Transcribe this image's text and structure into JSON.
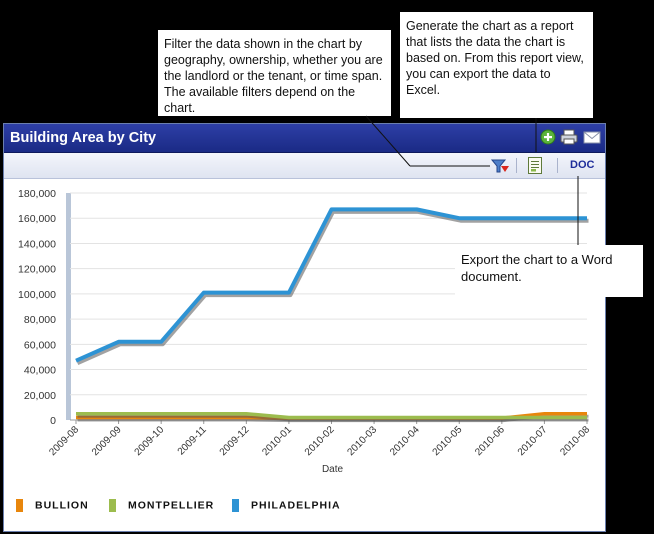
{
  "callouts": {
    "filter": "Filter the data shown in the chart by geography, ownership, whether you are the landlord or the tenant, or time span. The available filters depend on the chart.",
    "report": "Generate the chart as a report that lists the data the chart is based on. From this report view, you can export the data to Excel.",
    "doc": "Export the chart to a Word document."
  },
  "panel": {
    "title": "Building Area by City",
    "title_icons": [
      "add-icon",
      "print-icon",
      "email-icon"
    ],
    "toolbar": {
      "filter_icon": "filter-icon",
      "report_icon": "report-icon",
      "doc_label": "DOC"
    }
  },
  "colors": {
    "title_bar": "#2a3b9e",
    "bullion": "#e8860c",
    "montpellier": "#9cbc4e",
    "philadelphia": "#2d93d4"
  },
  "chart_data": {
    "type": "line",
    "xlabel": "Date",
    "ylabel": "",
    "x": [
      "2009-08",
      "2009-09",
      "2009-10",
      "2009-11",
      "2009-12",
      "2010-01",
      "2010-02",
      "2010-03",
      "2010-04",
      "2010-05",
      "2010-06",
      "2010-07",
      "2010-08"
    ],
    "ylim": [
      0,
      180000
    ],
    "yticks": [
      "0",
      "20,000",
      "40,000",
      "60,000",
      "80,000",
      "100,000",
      "120,000",
      "140,000",
      "160,000",
      "180,000"
    ],
    "grid": true,
    "legend": "bottom",
    "series": [
      {
        "name": "BULLION",
        "color": "#e8860c",
        "values": [
          2000,
          2000,
          2000,
          2000,
          2000,
          1500,
          1500,
          1500,
          1500,
          1500,
          1500,
          5000,
          5000
        ]
      },
      {
        "name": "MONTPELLIER",
        "color": "#9cbc4e",
        "values": [
          5000,
          5000,
          5000,
          5000,
          5000,
          2000,
          2000,
          2000,
          2000,
          2000,
          2000,
          2000,
          2000
        ]
      },
      {
        "name": "PHILADELPHIA",
        "color": "#2d93d4",
        "values": [
          47000,
          62000,
          62000,
          101000,
          101000,
          101000,
          167000,
          167000,
          167000,
          160000,
          160000,
          160000,
          160000
        ]
      }
    ]
  }
}
